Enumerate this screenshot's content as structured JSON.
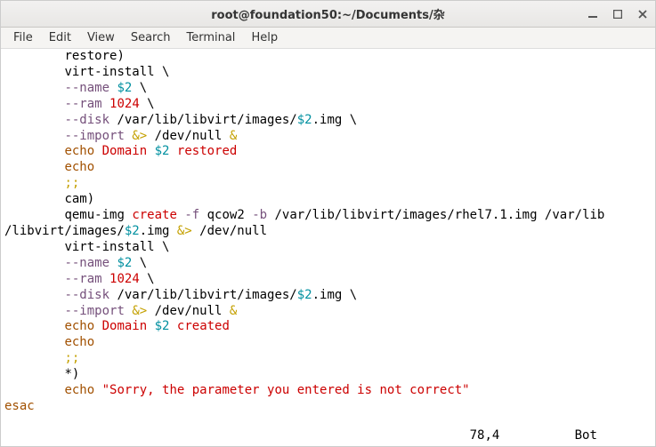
{
  "window": {
    "title": "root@foundation50:~/Documents/杂"
  },
  "menubar": {
    "items": [
      "File",
      "Edit",
      "View",
      "Search",
      "Terminal",
      "Help"
    ]
  },
  "status": {
    "pos": "78,4",
    "scroll": "Bot"
  },
  "code": {
    "indent8": "        ",
    "indent1": " ",
    "restore_case": "restore)",
    "cam_case": "cam)",
    "star_case": "*)",
    "virt_install": "virt-install",
    "qemu_img": "qemu-img",
    "create": "create",
    "dash_name": "--name",
    "dollar2": "$2",
    "dollar2_img": "$2",
    "img_suffix": ".img",
    "dash_ram": "--ram",
    "ram_val": "1024",
    "dash_disk": "--disk",
    "disk_path_prefix": " /var/lib/libvirt/images/",
    "dash_import": "--import",
    "amp_gt": "&>",
    "devnull": " /dev/null",
    "amp": " &",
    "echo": "echo",
    "Domain": "Domain",
    "restored": "restored",
    "created": "created",
    "dbl_semi": ";;",
    "dash_f": "-f",
    "qcow2": " qcow2 ",
    "dash_b": "-b",
    "rhel_path": " /var/lib/libvirt/images/rhel7.1.img /var/lib",
    "line2_prefix": "/libvirt/images/",
    "sorry_msg": "\"Sorry, the parameter you entered is not correct\"",
    "esac": "esac",
    "backslash": " \\",
    "sp": " "
  }
}
